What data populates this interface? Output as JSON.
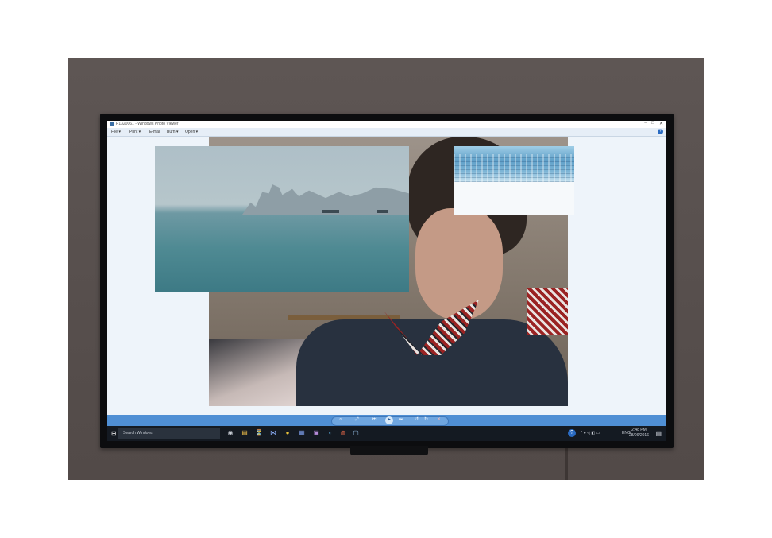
{
  "window": {
    "title": "P1320061 - Windows Photo Viewer",
    "controls": [
      "−",
      "□",
      "✕"
    ]
  },
  "menu": {
    "items": [
      "File ▾",
      "Print ▾",
      "E-mail",
      "Burn ▾",
      "Open ▾"
    ],
    "help": "?"
  },
  "viewer_controls": {
    "zoom": "⌕",
    "actual_size": "⤢",
    "prev": "⏮",
    "slideshow": "▶",
    "next": "⏭",
    "rotate_ccw": "↺",
    "rotate_cw": "↻",
    "delete": "✕"
  },
  "taskbar": {
    "start_icon": "⊞",
    "search_placeholder": "Search Windows",
    "pinned": [
      "◉",
      "▤",
      "⏳",
      "⋈",
      "●",
      "▦",
      "▣",
      "◐",
      "◍",
      "▢"
    ],
    "tray_help": "?",
    "tray_icons": "^ ● ◁ ◧ ▭",
    "lang": "ENG",
    "time": "2:48 PM",
    "date": "28/09/2016",
    "notifications": "▤"
  },
  "colors": {
    "taskbar": "#141a22",
    "controls_bar": "#4f8fd4",
    "menubar": "#e6eef7"
  }
}
